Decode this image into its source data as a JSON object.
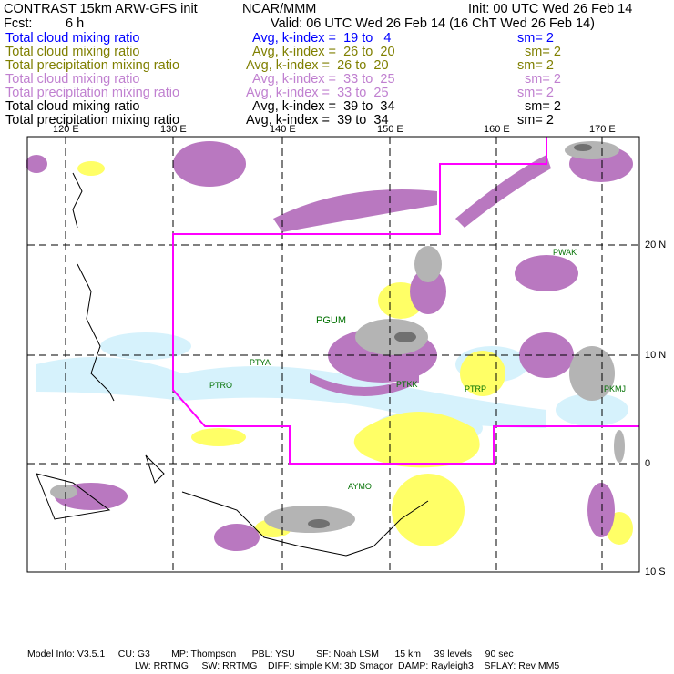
{
  "header": {
    "title": "CONTRAST 15km ARW-GFS init",
    "org": "NCAR/MMM",
    "init": "Init: 00 UTC Wed 26 Feb 14",
    "fcst_label": "Fcst:",
    "fcst_value": "6 h",
    "valid": "Valid: 06 UTC Wed 26 Feb 14 (16 ChT Wed 26 Feb 14)"
  },
  "fields": [
    {
      "name": "Total cloud mixing ratio",
      "avg": "Avg, k-index =  19 to   4",
      "sm": "sm= 2",
      "color": "#0000ff"
    },
    {
      "name": "Total cloud mixing ratio",
      "avg": "Avg, k-index =  26 to  20",
      "sm": "sm= 2",
      "color": "#7f7f00"
    },
    {
      "name": "Total precipitation mixing ratio",
      "avg": "Avg, k-index =  26 to  20",
      "sm": "sm= 2",
      "color": "#7f7f00"
    },
    {
      "name": "Total cloud mixing ratio",
      "avg": "Avg, k-index =  33 to  25",
      "sm": "sm= 2",
      "color": "#c080d0"
    },
    {
      "name": "Total precipitation mixing ratio",
      "avg": "Avg, k-index =  33 to  25",
      "sm": "sm= 2",
      "color": "#c080d0"
    },
    {
      "name": "Total cloud mixing ratio",
      "avg": "Avg, k-index =  39 to  34",
      "sm": "sm= 2",
      "color": "#000000"
    },
    {
      "name": "Total precipitation mixing ratio",
      "avg": "Avg, k-index =  39 to  34",
      "sm": "sm= 2",
      "color": "#000000"
    }
  ],
  "map": {
    "lon_labels": [
      "120 E",
      "130 E",
      "140 E",
      "150 E",
      "160 E",
      "170 E"
    ],
    "lat_labels": [
      "20 N",
      "10 N",
      "0",
      "10 S"
    ],
    "stations": [
      "PGUM",
      "PWAK",
      "PTYA",
      "PTRO",
      "PTKK",
      "PTRP",
      "PKMJ",
      "AYMO"
    ],
    "colors": {
      "pink": "#b978c0",
      "yellow": "#ffff66",
      "lightblue": "#d6f2fc",
      "gray": "#b4b4b4",
      "boundary": "#ff00ff"
    }
  },
  "footer": {
    "line1": "Model Info: V3.5.1     CU: G3        MP: Thompson      PBL: YSU        SF: Noah LSM      15 km     39 levels     90 sec",
    "line2": "LW: RRTMG     SW: RRTMG    DIFF: simple KM: 3D Smagor  DAMP: Rayleigh3    SFLAY: Rev MM5"
  }
}
